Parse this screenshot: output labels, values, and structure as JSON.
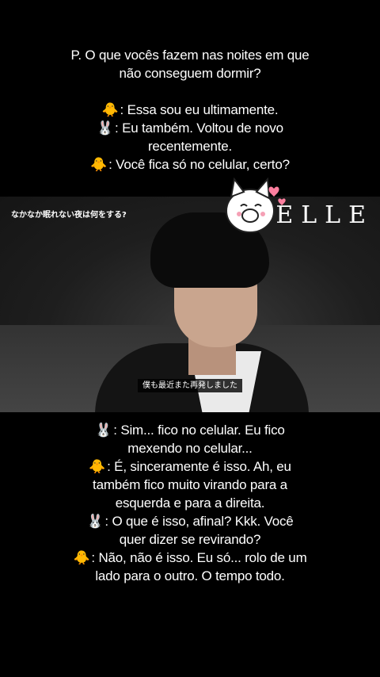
{
  "top_caption": {
    "question_line1": "P. O que vocês fazem nas noites em que",
    "question_line2": "não conseguem dormir?",
    "chick_emoji": "🐥",
    "rabbit_emoji": "🐰",
    "line1": ": Essa sou eu ultimamente.",
    "line2a": ": Eu também. Voltou de novo",
    "line2b": "recentemente.",
    "line3": ": Você fica só no celular, certo?"
  },
  "video": {
    "japanese_title": "なかなか眠れない夜は何をする?",
    "brand": "ELLE",
    "subtitle": "僕も最近また再発しました"
  },
  "bottom_caption": {
    "l1a": ": Sim... fico no celular. Eu fico",
    "l1b": "mexendo no celular...",
    "l2a": ": É, sinceramente é isso. Ah, eu",
    "l2b": "também fico muito virando para a",
    "l2c": "esquerda e para a direita.",
    "l3a": ": O que é isso, afinal? Kkk. Você",
    "l3b": "quer dizer se revirando?",
    "l4a": ": Não, não é isso. Eu só... rolo de um",
    "l4b": "lado para o outro. O tempo todo."
  }
}
